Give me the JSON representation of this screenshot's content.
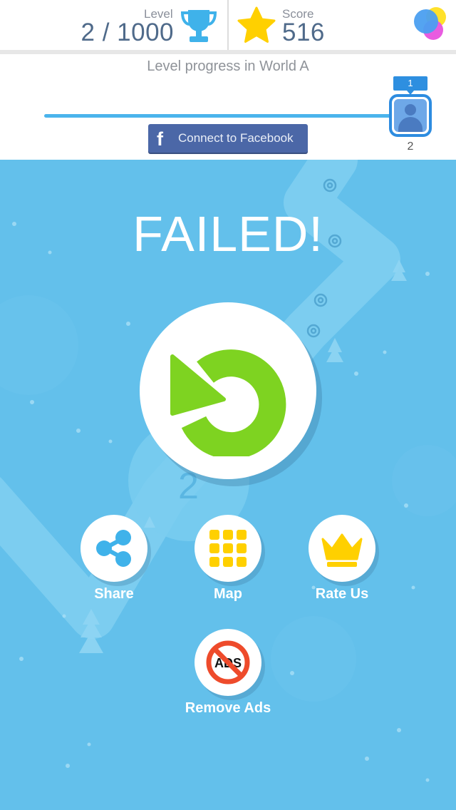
{
  "header": {
    "level_label": "Level",
    "level_value": "2 / 1000",
    "score_label": "Score",
    "score_value": "516",
    "icons": {
      "level": "trophy-icon",
      "score": "star-icon",
      "app": "bubbles-icon"
    },
    "colors": {
      "trophy": "#3fb2ea",
      "star": "#ffd000",
      "value_text": "#4f6a8a"
    }
  },
  "progress": {
    "title": "Level progress in World A",
    "player_rank": "1",
    "player_level": "2",
    "facebook_button": "Connect to Facebook",
    "facebook_icon": "f"
  },
  "result": {
    "title": "FAILED!",
    "retry_icon": "retry-arrow-icon",
    "retry_color": "#7ed321"
  },
  "menu": {
    "share": "Share",
    "map": "Map",
    "rate": "Rate Us",
    "remove_ads": "Remove Ads",
    "ads_sign_text": "ADS"
  },
  "background": {
    "path_level_number": "2"
  }
}
